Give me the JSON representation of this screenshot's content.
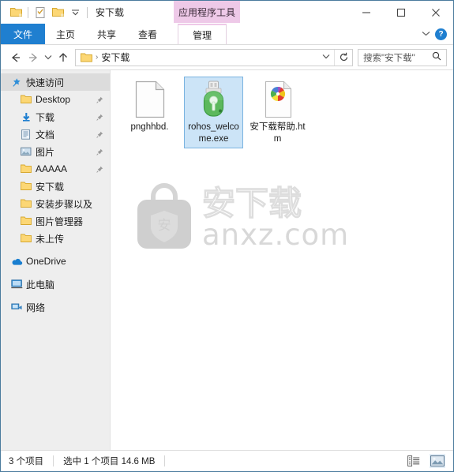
{
  "window": {
    "title": "安下载",
    "app_icon": "folder-icon",
    "quick_access_toolbar": [
      {
        "name": "folder-icon",
        "label": ""
      },
      {
        "name": "properties-icon",
        "label": ""
      },
      {
        "name": "new-folder-icon",
        "label": ""
      },
      {
        "name": "chevron-down-icon",
        "label": ""
      }
    ],
    "controls": {
      "minimize": "minimize-icon",
      "maximize": "maximize-icon",
      "close": "close-icon"
    }
  },
  "contextual_tab": {
    "label": "应用程序工具",
    "color": "#eec9e8"
  },
  "ribbon": {
    "tabs": [
      {
        "label": "文件",
        "active": true
      },
      {
        "label": "主页",
        "active": false
      },
      {
        "label": "共享",
        "active": false
      },
      {
        "label": "查看",
        "active": false
      }
    ],
    "contextual_tab_label": "管理",
    "collapse_icon": "chevron-down-icon",
    "help_label": "?",
    "accent_color": "#1f7fd0"
  },
  "address_bar": {
    "back_icon": "arrow-left-icon",
    "forward_icon": "arrow-right-icon",
    "recent_icon": "chevron-down-icon",
    "up_icon": "arrow-up-icon",
    "path_icon": "folder-icon",
    "path_separator": "›",
    "path_text": "安下载",
    "dropdown_icon": "chevron-down-icon",
    "refresh_icon": "refresh-icon"
  },
  "search": {
    "placeholder": "搜索\"安下载\"",
    "icon": "search-icon"
  },
  "sidebar": {
    "items": [
      {
        "label": "快速访问",
        "icon": "star-pin-icon",
        "selected": true,
        "indent": false,
        "pinned": false,
        "root": false
      },
      {
        "label": "Desktop",
        "icon": "folder-icon",
        "selected": false,
        "indent": true,
        "pinned": true,
        "root": false
      },
      {
        "label": "下载",
        "icon": "download-icon",
        "selected": false,
        "indent": true,
        "pinned": true,
        "root": false
      },
      {
        "label": "文档",
        "icon": "documents-icon",
        "selected": false,
        "indent": true,
        "pinned": true,
        "root": false
      },
      {
        "label": "图片",
        "icon": "pictures-icon",
        "selected": false,
        "indent": true,
        "pinned": true,
        "root": false
      },
      {
        "label": "AAAAA",
        "icon": "folder-icon",
        "selected": false,
        "indent": true,
        "pinned": true,
        "root": false
      },
      {
        "label": "安下载",
        "icon": "folder-icon",
        "selected": false,
        "indent": true,
        "pinned": false,
        "root": false
      },
      {
        "label": "安装步骤以及",
        "icon": "folder-icon",
        "selected": false,
        "indent": true,
        "pinned": false,
        "root": false
      },
      {
        "label": "图片管理器",
        "icon": "folder-icon",
        "selected": false,
        "indent": true,
        "pinned": false,
        "root": false
      },
      {
        "label": "未上传",
        "icon": "folder-icon",
        "selected": false,
        "indent": true,
        "pinned": false,
        "root": false
      },
      {
        "label": "OneDrive",
        "icon": "onedrive-icon",
        "selected": false,
        "indent": false,
        "pinned": false,
        "root": true
      },
      {
        "label": "此电脑",
        "icon": "this-pc-icon",
        "selected": false,
        "indent": false,
        "pinned": false,
        "root": true
      },
      {
        "label": "网络",
        "icon": "network-icon",
        "selected": false,
        "indent": false,
        "pinned": false,
        "root": true
      }
    ]
  },
  "files": [
    {
      "name": "pnghhbd.",
      "icon": "blank-document-icon",
      "selected": false
    },
    {
      "name": "rohos_welcome.exe",
      "icon": "usb-key-icon",
      "selected": true
    },
    {
      "name": "安下载帮助.htm",
      "icon": "html-pinwheel-icon",
      "selected": false
    }
  ],
  "watermark": {
    "logo_char": "安",
    "brand": "安下载",
    "site": "anxz.com",
    "color": "#d8d8d8"
  },
  "status_bar": {
    "item_count": "3 个项目",
    "selection": "选中 1 个项目  14.6 MB",
    "views": [
      {
        "name": "details-view-button",
        "active": false
      },
      {
        "name": "large-icons-view-button",
        "active": true
      }
    ]
  }
}
